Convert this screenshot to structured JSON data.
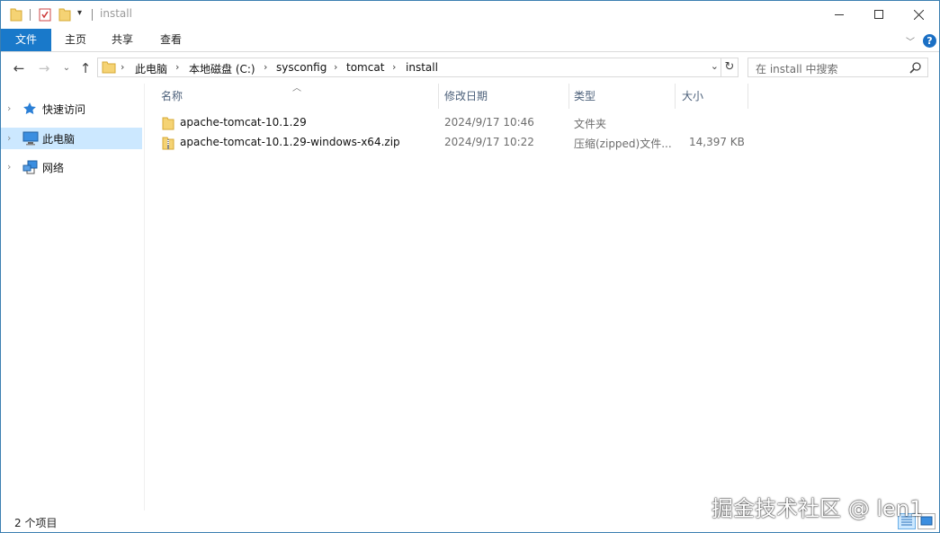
{
  "window": {
    "title": "install",
    "controls": {
      "minimize": "—",
      "maximize": "☐",
      "close": "✕"
    }
  },
  "ribbon": {
    "tabs": [
      "文件",
      "主页",
      "共享",
      "查看"
    ],
    "help": "?"
  },
  "address": {
    "breadcrumbs": [
      "此电脑",
      "本地磁盘 (C:)",
      "sysconfig",
      "tomcat",
      "install"
    ]
  },
  "search": {
    "placeholder": "在 install 中搜索"
  },
  "navpane": {
    "items": [
      {
        "label": "快速访问",
        "icon": "star-icon",
        "selected": false
      },
      {
        "label": "此电脑",
        "icon": "computer-icon",
        "selected": true
      },
      {
        "label": "网络",
        "icon": "network-icon",
        "selected": false
      }
    ]
  },
  "columns": {
    "name": "名称",
    "modified": "修改日期",
    "type": "类型",
    "size": "大小"
  },
  "files": [
    {
      "name": "apache-tomcat-10.1.29",
      "modified": "2024/9/17 10:46",
      "type": "文件夹",
      "size": "",
      "icon": "folder-icon"
    },
    {
      "name": "apache-tomcat-10.1.29-windows-x64.zip",
      "modified": "2024/9/17 10:22",
      "type": "压缩(zipped)文件...",
      "size": "14,397 KB",
      "icon": "zip-folder-icon"
    }
  ],
  "status": {
    "item_count": "2 个项目"
  },
  "watermark": "掘金技术社区 @ len1",
  "colors": {
    "accent": "#1979ca",
    "selection": "#cce8ff",
    "header_text": "#4c607a"
  }
}
